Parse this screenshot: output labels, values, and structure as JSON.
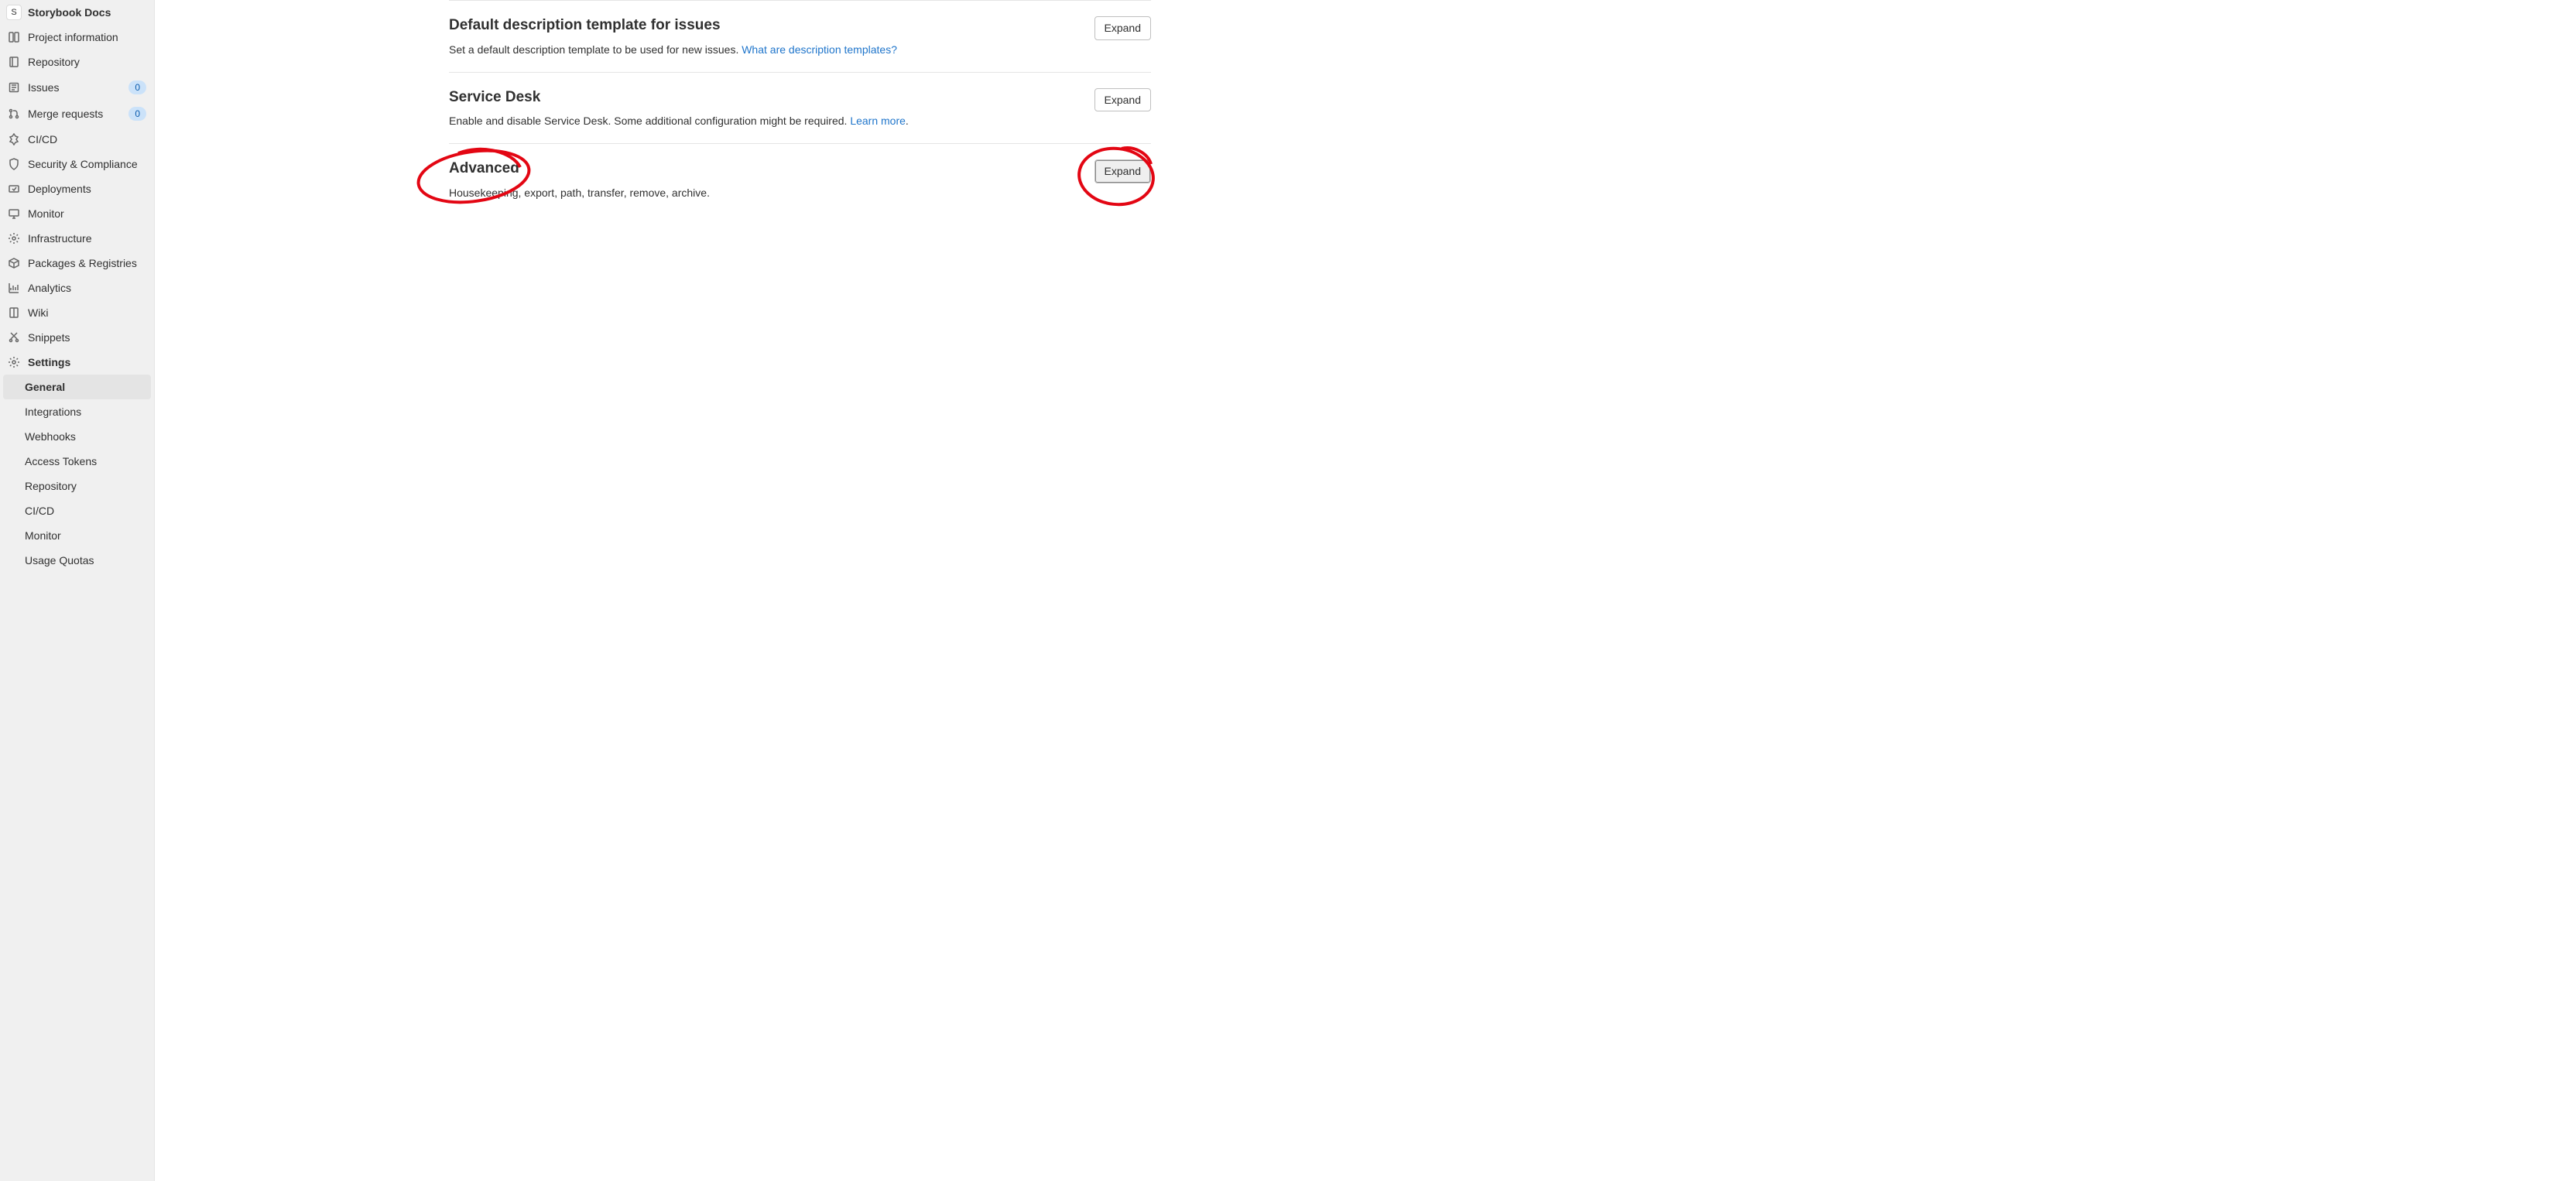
{
  "project": {
    "avatar_letter": "S",
    "name": "Storybook Docs"
  },
  "sidebar": {
    "items": [
      {
        "label": "Project information",
        "icon": "project-info-icon"
      },
      {
        "label": "Repository",
        "icon": "repository-icon"
      },
      {
        "label": "Issues",
        "icon": "issues-icon",
        "badge": "0"
      },
      {
        "label": "Merge requests",
        "icon": "merge-requests-icon",
        "badge": "0"
      },
      {
        "label": "CI/CD",
        "icon": "cicd-icon"
      },
      {
        "label": "Security & Compliance",
        "icon": "shield-icon"
      },
      {
        "label": "Deployments",
        "icon": "deployments-icon"
      },
      {
        "label": "Monitor",
        "icon": "monitor-icon"
      },
      {
        "label": "Infrastructure",
        "icon": "infrastructure-icon"
      },
      {
        "label": "Packages & Registries",
        "icon": "packages-icon"
      },
      {
        "label": "Analytics",
        "icon": "analytics-icon"
      },
      {
        "label": "Wiki",
        "icon": "wiki-icon"
      },
      {
        "label": "Snippets",
        "icon": "snippets-icon"
      },
      {
        "label": "Settings",
        "icon": "settings-icon"
      }
    ],
    "settings_children": [
      {
        "label": "General"
      },
      {
        "label": "Integrations"
      },
      {
        "label": "Webhooks"
      },
      {
        "label": "Access Tokens"
      },
      {
        "label": "Repository"
      },
      {
        "label": "CI/CD"
      },
      {
        "label": "Monitor"
      },
      {
        "label": "Usage Quotas"
      }
    ]
  },
  "sections": [
    {
      "title": "Default description template for issues",
      "desc_prefix": "Set a default description template to be used for new issues. ",
      "link_text": "What are description templates?",
      "desc_suffix": "",
      "button": "Expand"
    },
    {
      "title": "Service Desk",
      "desc_prefix": "Enable and disable Service Desk. Some additional configuration might be required. ",
      "link_text": "Learn more",
      "desc_suffix": ".",
      "button": "Expand"
    },
    {
      "title": "Advanced",
      "desc_prefix": "Housekeeping, export, path, transfer, remove, archive.",
      "link_text": "",
      "desc_suffix": "",
      "button": "Expand"
    }
  ]
}
